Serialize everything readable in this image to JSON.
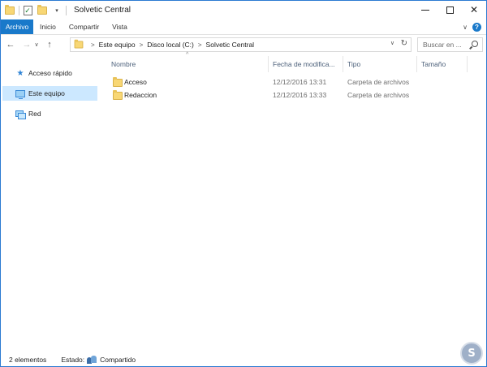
{
  "window": {
    "title": "Solvetic Central",
    "controls": {
      "minimize": "",
      "maximize": "",
      "close": "✕"
    }
  },
  "quick_access": {
    "icons": [
      "folder-icon",
      "properties-icon",
      "new-folder-icon",
      "customize-dropdown-icon"
    ],
    "properties_glyph": "✓",
    "dropdown_glyph": "▾"
  },
  "ribbon": {
    "tabs": [
      "Archivo",
      "Inicio",
      "Compartir",
      "Vista"
    ],
    "active_tab": "Archivo",
    "accent_color": "#1979ca",
    "expand_glyph": "∨",
    "help_glyph": "?"
  },
  "navigation": {
    "back": "←",
    "forward": "→",
    "recent": "∨",
    "up": "↑",
    "breadcrumb": [
      "Este equipo",
      "Disco local (C:)",
      "Solvetic Central"
    ],
    "separator": ">",
    "dropdown": "∨",
    "refresh": "↻",
    "search_placeholder": "Buscar en ..."
  },
  "sidebar": {
    "items": [
      {
        "label": "Acceso rápido",
        "icon": "star-icon",
        "glyph": "★",
        "selected": false
      },
      {
        "label": "Este equipo",
        "icon": "computer-icon",
        "selected": true
      },
      {
        "label": "Red",
        "icon": "network-icon",
        "selected": false
      }
    ]
  },
  "file_list": {
    "columns": [
      "Nombre",
      "Fecha de modifica...",
      "Tipo",
      "Tamaño"
    ],
    "sort_glyph": "^",
    "rows": [
      {
        "name": "Acceso",
        "date": "12/12/2016 13:31",
        "type": "Carpeta de archivos",
        "size": ""
      },
      {
        "name": "Redaccion",
        "date": "12/12/2016 13:33",
        "type": "Carpeta de archivos",
        "size": ""
      }
    ]
  },
  "status_bar": {
    "count": "2 elementos",
    "state_label": "Estado:",
    "state_value": "Compartido"
  },
  "watermark": {
    "glyph": "S"
  }
}
